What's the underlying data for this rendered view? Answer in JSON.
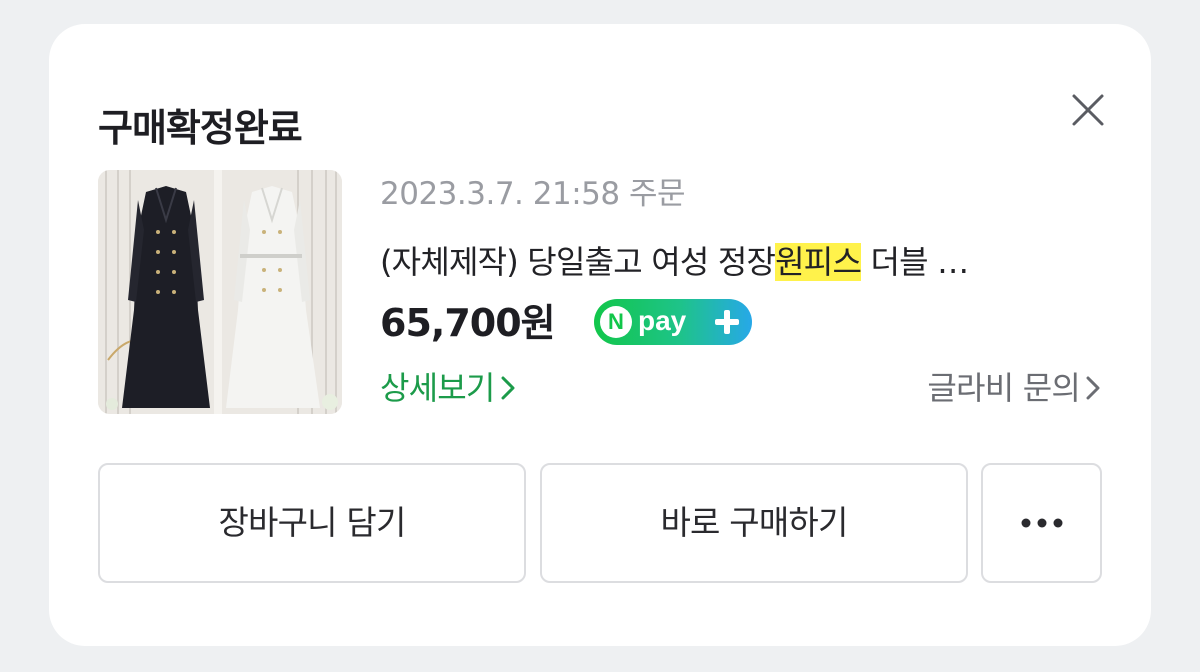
{
  "header": {
    "title": "구매확정완료",
    "close_icon": "close-icon"
  },
  "order": {
    "date": "2023.3.7. 21:58 주문",
    "product_name_prefix": "(자체제작) 당일출고 여성 정장",
    "product_name_highlight": "원피스",
    "product_name_suffix": " 더블 …",
    "price": "65,700원",
    "npay_badge": {
      "n": "N",
      "label": "pay",
      "icon": "plus-icon"
    },
    "image": "dress-photo"
  },
  "links": {
    "detail": "상세보기",
    "inquiry": "글라비 문의"
  },
  "buttons": {
    "cart": "장바구니 담기",
    "buy": "바로 구매하기",
    "more_icon": "more-dots-icon"
  },
  "colors": {
    "accent_green": "#1c9b4a",
    "highlight": "#fff24b",
    "npay_green": "#12c64a",
    "npay_blue": "#27a8e8"
  }
}
